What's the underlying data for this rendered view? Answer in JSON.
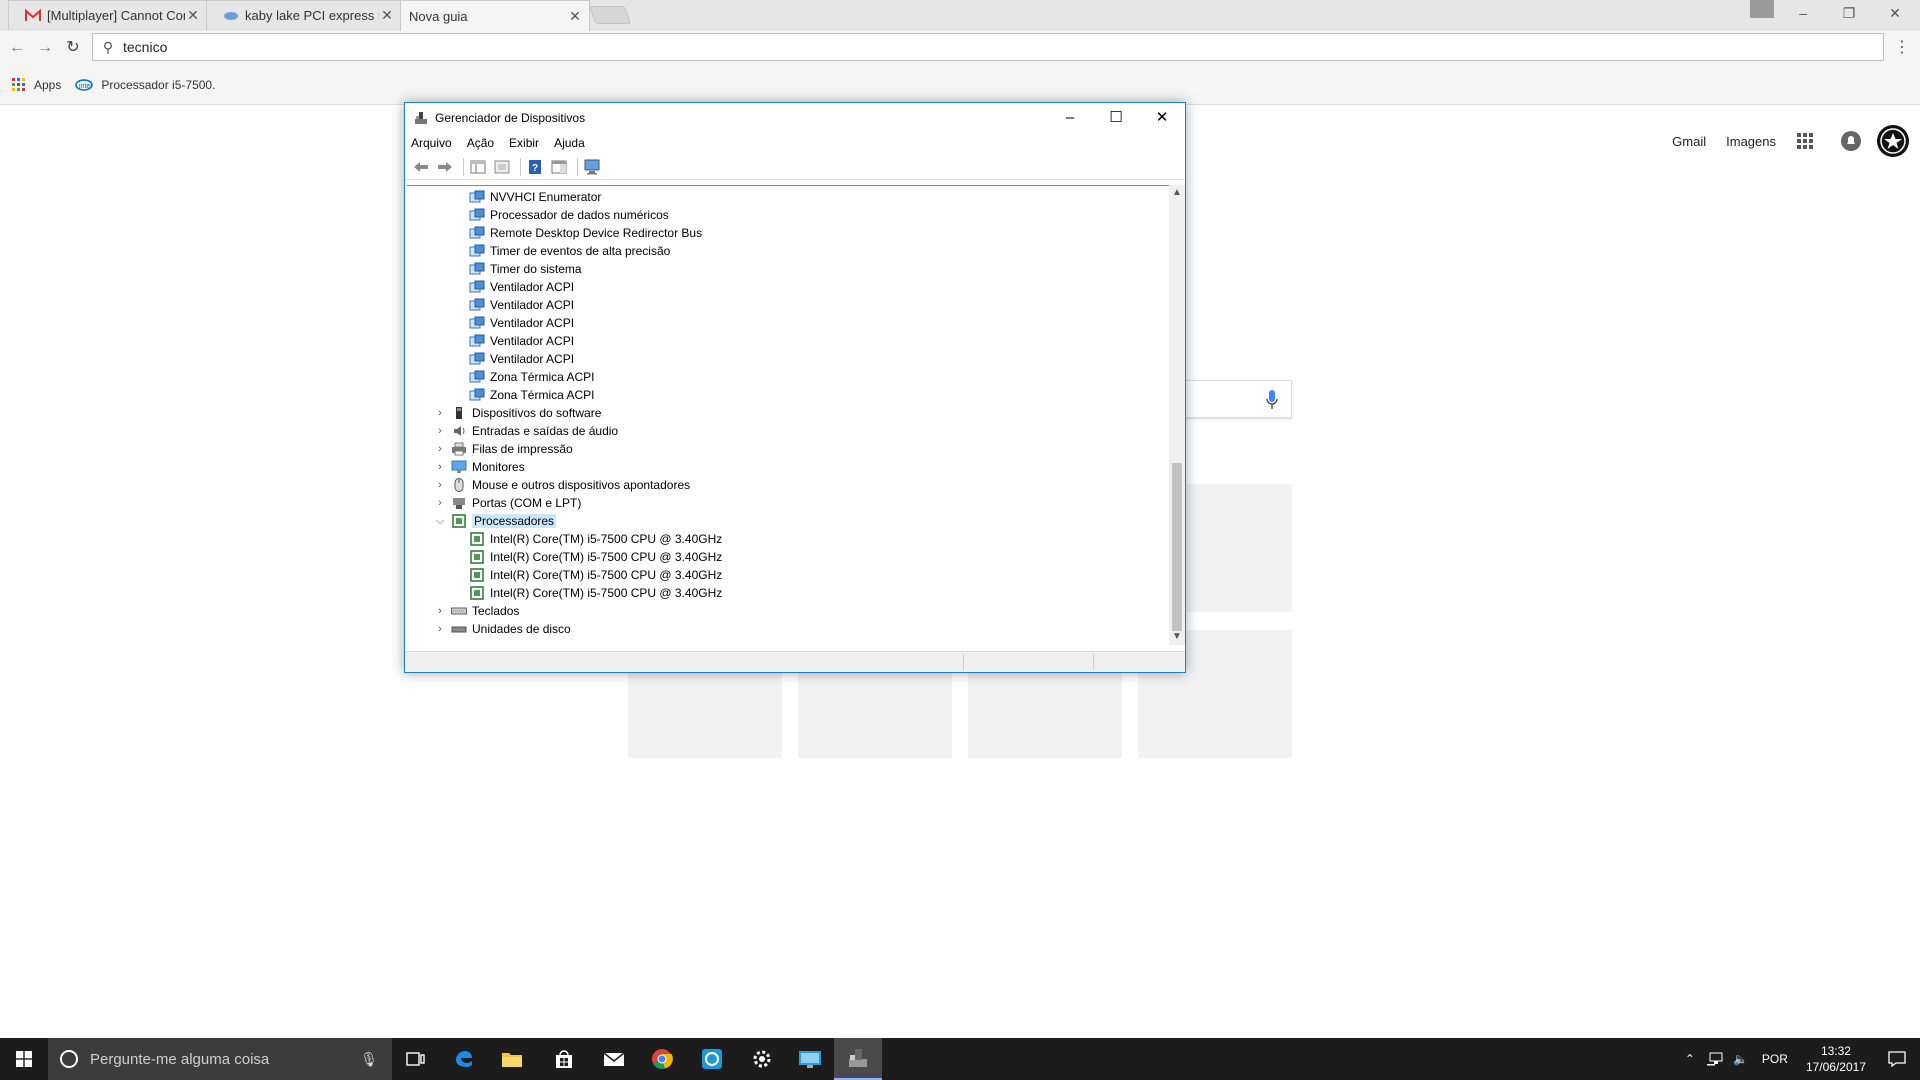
{
  "browser": {
    "tabs": [
      {
        "title": "[Multiplayer] Cannot Con",
        "favicon": "gmail-icon",
        "active": false
      },
      {
        "title": "kaby lake PCI express roo",
        "favicon": "tomshardware-icon",
        "active": false
      },
      {
        "title": "Nova guia",
        "favicon": "",
        "active": true
      }
    ],
    "omnibox_value": "tecnico",
    "bookmarks": [
      {
        "label": "Apps",
        "icon": "apps-grid-icon"
      },
      {
        "label": "Processador i5-7500.",
        "icon": "intel-icon"
      }
    ]
  },
  "google": {
    "links": [
      "Gmail",
      "Imagens"
    ]
  },
  "device_manager": {
    "title": "Gerenciador de Dispositivos",
    "menu": [
      "Arquivo",
      "Ação",
      "Exibir",
      "Ajuda"
    ],
    "tree": [
      {
        "label": "NVVHCI Enumerator",
        "level": 2,
        "icon": "system-device-icon"
      },
      {
        "label": "Processador de dados numéricos",
        "level": 2,
        "icon": "system-device-icon"
      },
      {
        "label": "Remote Desktop Device Redirector Bus",
        "level": 2,
        "icon": "system-device-icon"
      },
      {
        "label": "Timer de eventos de alta precisão",
        "level": 2,
        "icon": "system-device-icon"
      },
      {
        "label": "Timer do sistema",
        "level": 2,
        "icon": "system-device-icon"
      },
      {
        "label": "Ventilador ACPI",
        "level": 2,
        "icon": "system-device-icon"
      },
      {
        "label": "Ventilador ACPI",
        "level": 2,
        "icon": "system-device-icon"
      },
      {
        "label": "Ventilador ACPI",
        "level": 2,
        "icon": "system-device-icon"
      },
      {
        "label": "Ventilador ACPI",
        "level": 2,
        "icon": "system-device-icon"
      },
      {
        "label": "Ventilador ACPI",
        "level": 2,
        "icon": "system-device-icon"
      },
      {
        "label": "Zona Térmica ACPI",
        "level": 2,
        "icon": "system-device-icon"
      },
      {
        "label": "Zona Térmica ACPI",
        "level": 2,
        "icon": "system-device-icon"
      },
      {
        "label": "Dispositivos do software",
        "level": 1,
        "icon": "software-device-icon",
        "expander": "collapsed"
      },
      {
        "label": "Entradas e saídas de áudio",
        "level": 1,
        "icon": "audio-icon",
        "expander": "collapsed"
      },
      {
        "label": "Filas de impressão",
        "level": 1,
        "icon": "printer-icon",
        "expander": "collapsed"
      },
      {
        "label": "Monitores",
        "level": 1,
        "icon": "monitor-icon",
        "expander": "collapsed"
      },
      {
        "label": "Mouse e outros dispositivos apontadores",
        "level": 1,
        "icon": "mouse-icon",
        "expander": "collapsed"
      },
      {
        "label": "Portas (COM e LPT)",
        "level": 1,
        "icon": "port-icon",
        "expander": "collapsed"
      },
      {
        "label": "Processadores",
        "level": 1,
        "icon": "processor-icon",
        "expander": "expanded",
        "selected": true
      },
      {
        "label": "Intel(R) Core(TM) i5-7500 CPU @ 3.40GHz",
        "level": 2,
        "icon": "processor-icon"
      },
      {
        "label": "Intel(R) Core(TM) i5-7500 CPU @ 3.40GHz",
        "level": 2,
        "icon": "processor-icon"
      },
      {
        "label": "Intel(R) Core(TM) i5-7500 CPU @ 3.40GHz",
        "level": 2,
        "icon": "processor-icon"
      },
      {
        "label": "Intel(R) Core(TM) i5-7500 CPU @ 3.40GHz",
        "level": 2,
        "icon": "processor-icon"
      },
      {
        "label": "Teclados",
        "level": 1,
        "icon": "keyboard-icon",
        "expander": "collapsed"
      },
      {
        "label": "Unidades de disco",
        "level": 1,
        "icon": "disk-drive-icon",
        "expander": "collapsed"
      }
    ]
  },
  "taskbar": {
    "search_placeholder": "Pergunte-me alguma coisa",
    "apps": [
      "task-view-icon",
      "edge-icon",
      "file-explorer-icon",
      "store-icon",
      "mail-icon",
      "chrome-icon",
      "uplay-icon",
      "settings-icon",
      "remote-desktop-icon",
      "device-manager-icon"
    ],
    "language": "POR",
    "time": "13:32",
    "date": "17/06/2017"
  },
  "colors": {
    "window_border": "#1a7dd7",
    "selection": "#cce8ff",
    "taskbar": "#1c1c1c"
  }
}
